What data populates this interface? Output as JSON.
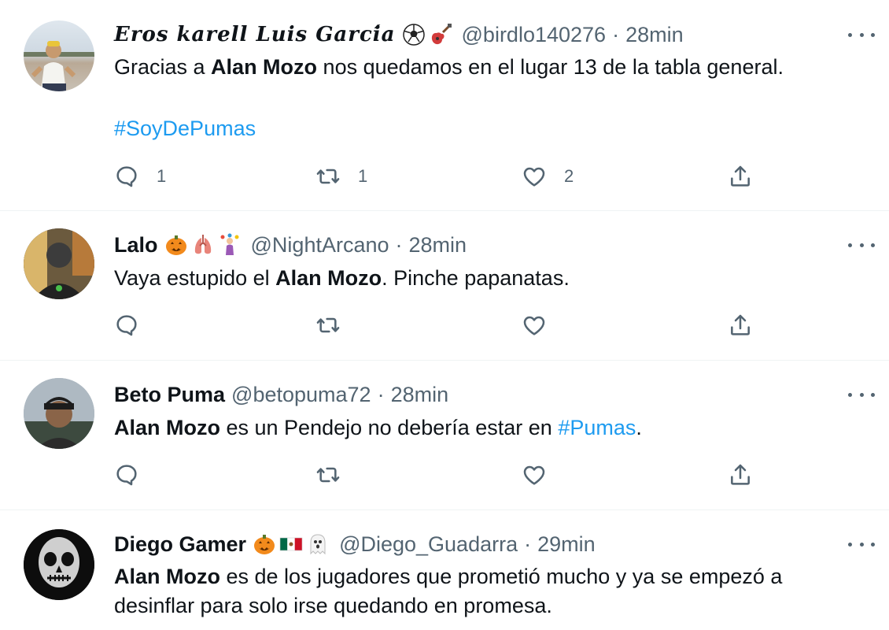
{
  "colors": {
    "link": "#1d9bf0",
    "secondary": "#536471",
    "text": "#0f1419",
    "divider": "#eff3f4"
  },
  "tweets": [
    {
      "name": "𝑬𝒓𝒐𝒔 𝒌𝒂𝒓𝒆𝒍𝒍 𝑳𝒖𝒊𝒔 𝑮𝒂𝒓𝒄𝒊́𝒂",
      "emojis": [
        "soccer-ball",
        "guitar"
      ],
      "handle": "@birdlo140276",
      "dot": "·",
      "time": "28min",
      "text_pre": "Gracias a ",
      "text_bold": "Alan Mozo",
      "text_post": " nos quedamos en el lugar 13 de la tabla general.",
      "hashtag": "#SoyDePumas",
      "replies": "1",
      "retweets": "1",
      "likes": "2"
    },
    {
      "name": "Lalo",
      "emojis": [
        "jack-o-lantern",
        "lungs",
        "woman-juggling"
      ],
      "handle": "@NightArcano",
      "dot": "·",
      "time": "28min",
      "text_pre": "Vaya estupido el ",
      "text_bold": "Alan Mozo",
      "text_post": ". Pinche papanatas."
    },
    {
      "name": "Beto Puma",
      "emojis": [],
      "handle": "@betopuma72",
      "dot": "·",
      "time": "28min",
      "text_bold": "Alan Mozo",
      "text_mid": " es un Pendejo no debería estar en ",
      "hashtag": "#Pumas",
      "text_post": "."
    },
    {
      "name": "Diego Gamer",
      "emojis": [
        "jack-o-lantern",
        "mexico-flag",
        "ghost"
      ],
      "handle": "@Diego_Guadarra",
      "dot": "·",
      "time": "29min",
      "text_bold": "Alan Mozo",
      "text_post": " es de los jugadores que prometió mucho y ya se empezó a desinflar para solo irse quedando en promesa."
    }
  ],
  "icons": {
    "reply": "reply-icon",
    "retweet": "retweet-icon",
    "like": "heart-icon",
    "share": "share-icon",
    "more": "more-dots-icon"
  }
}
